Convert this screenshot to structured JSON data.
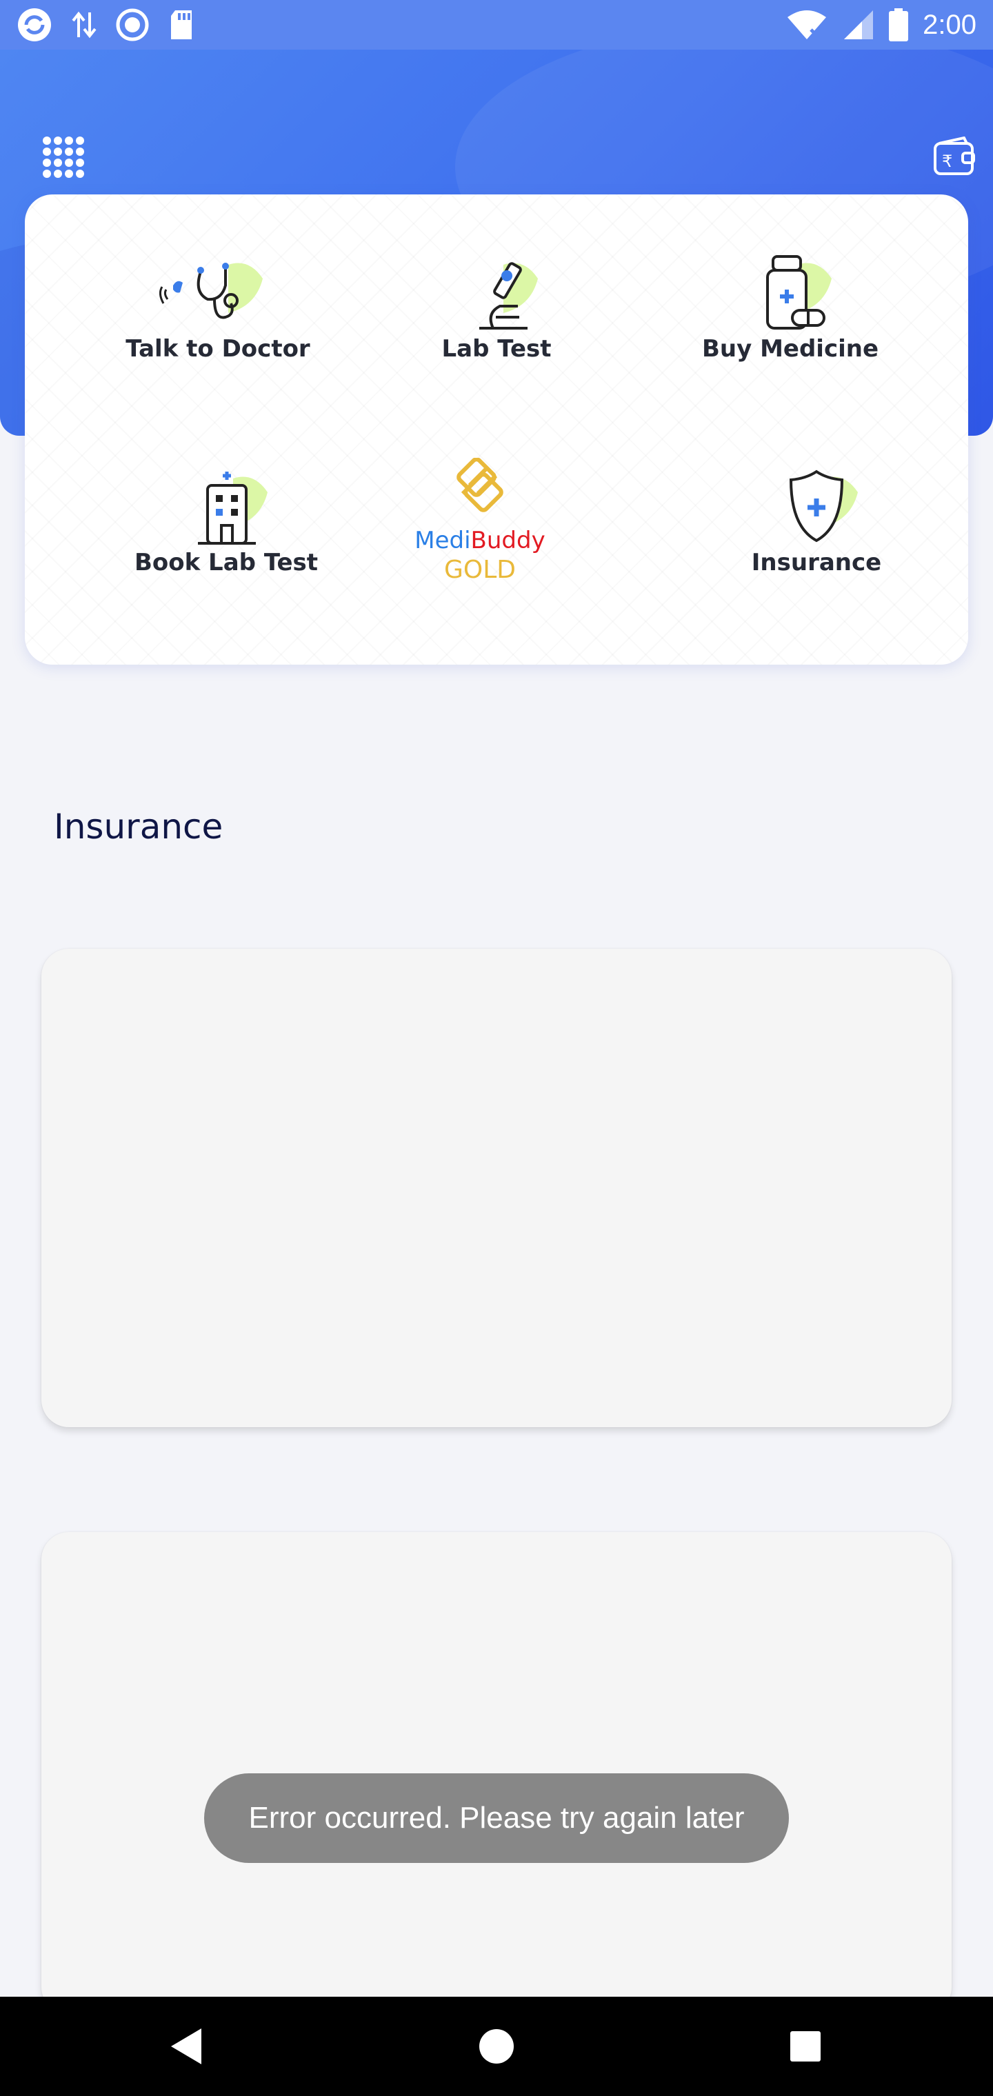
{
  "status_bar": {
    "time": "2:00",
    "icons": [
      "app-sync-icon",
      "data-arrows-icon",
      "record-icon",
      "sd-card-icon",
      "wifi-off-icon",
      "signal-icon",
      "battery-icon"
    ]
  },
  "header": {
    "menu_icon": "grid-menu-icon",
    "wallet_icon": "rupee-wallet-icon"
  },
  "services": [
    {
      "label": "Talk to Doctor",
      "icon": "stethoscope-icon"
    },
    {
      "label": "Lab Test",
      "icon": "microscope-icon"
    },
    {
      "label": "Buy Medicine",
      "icon": "medicine-bottle-icon"
    },
    {
      "label": "Book Lab Test",
      "icon": "hospital-building-icon"
    },
    {
      "label": "Insurance",
      "icon": "shield-plus-icon"
    }
  ],
  "gold": {
    "medi": "Medi",
    "buddy": "Buddy",
    "gold": "GOLD",
    "icon": "medibuddy-gold-logo-icon"
  },
  "insurance_section": {
    "title": "Insurance"
  },
  "toast": {
    "message": "Error occurred. Please try again later"
  },
  "nav": {
    "icons": [
      "back-icon",
      "home-icon",
      "recents-icon"
    ]
  },
  "colors": {
    "brand_blue": "#3e6fee",
    "accent_green": "#d9f79b",
    "gold": "#e9b93a",
    "red": "#e21a22",
    "title_navy": "#0f1646"
  }
}
